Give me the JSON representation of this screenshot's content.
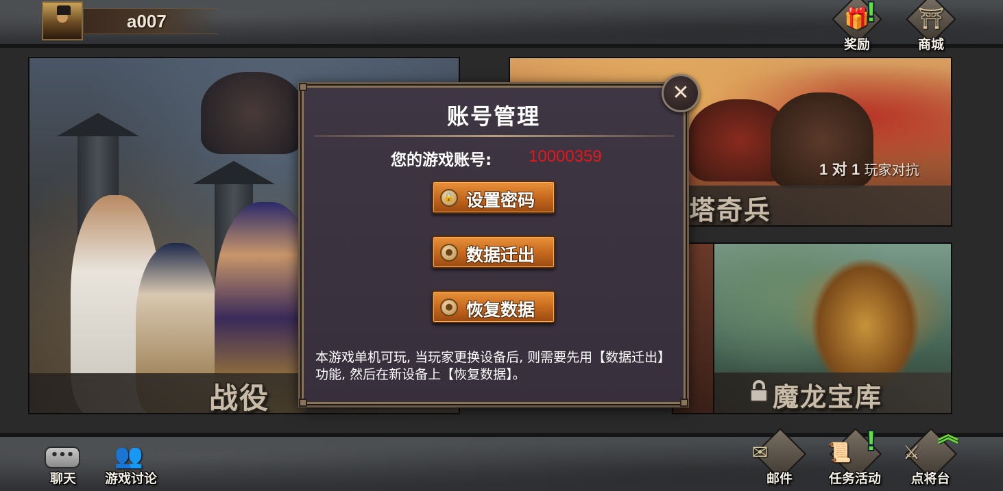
{
  "player": {
    "name": "a007"
  },
  "top_right": {
    "rewards_label": "奖励",
    "rewards_alert": "!",
    "shop_label": "商城"
  },
  "modes": {
    "campaign_title": "战役",
    "pvp_title": "塔奇兵",
    "pvp_mode": {
      "num1": "1",
      "vs": "对",
      "num2": "1",
      "text": "玩家对抗"
    },
    "dragon_title": "魔龙宝库"
  },
  "dialog": {
    "title": "账号管理",
    "account_label": "您的游戏账号:",
    "account_value": "10000359",
    "buttons": {
      "set_password": "设置密码",
      "export_data": "数据迁出",
      "restore_data": "恢复数据"
    },
    "note": "本游戏单机可玩, 当玩家更换设备后, 则需要先用【数据迁出】功能, 然后在新设备上【恢复数据】。",
    "close_symbol": "✕"
  },
  "bottom_left": {
    "chat_label": "聊天",
    "forum_label": "游戏讨论"
  },
  "bottom_right": {
    "mail_label": "邮件",
    "quest_label": "任务活动",
    "quest_alert": "!",
    "general_label": "点将台"
  },
  "icons": {
    "avatar": "general-portrait",
    "rewards": "gift-icon",
    "shop": "pagoda-icon",
    "mail": "envelope-icon",
    "quest": "scroll-icon",
    "general": "sword-icon",
    "chat": "chat-bubble-icon",
    "forum": "people-icon",
    "lock": "lock-icon",
    "close": "close-icon"
  },
  "colors": {
    "account_value": "#e8161a",
    "alert": "#5fe03a",
    "button": "#c86a1e",
    "dialog_bg": "#3f3644"
  }
}
